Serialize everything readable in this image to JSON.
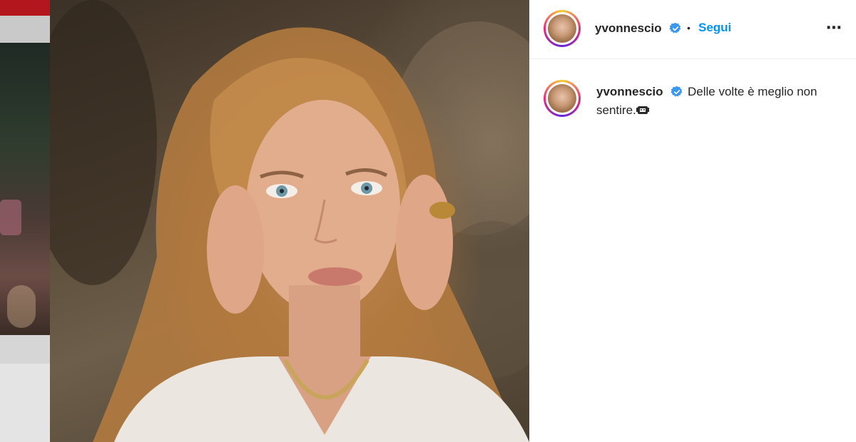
{
  "post": {
    "author": {
      "username": "yvonnescio",
      "verified": true
    },
    "follow_label": "Segui",
    "separator": "•",
    "more_icon": "⋯",
    "caption": {
      "username": "yvonnescio",
      "text_line1": "Delle volte è meglio non",
      "text_line2": "sentire."
    }
  },
  "colors": {
    "accent": "#0095f6",
    "verified": "#3897f0",
    "text": "#262626",
    "divider": "#efefef"
  },
  "icons": [
    "verified-badge-icon",
    "more-options-icon",
    "ear-covering-emoji-icon"
  ]
}
